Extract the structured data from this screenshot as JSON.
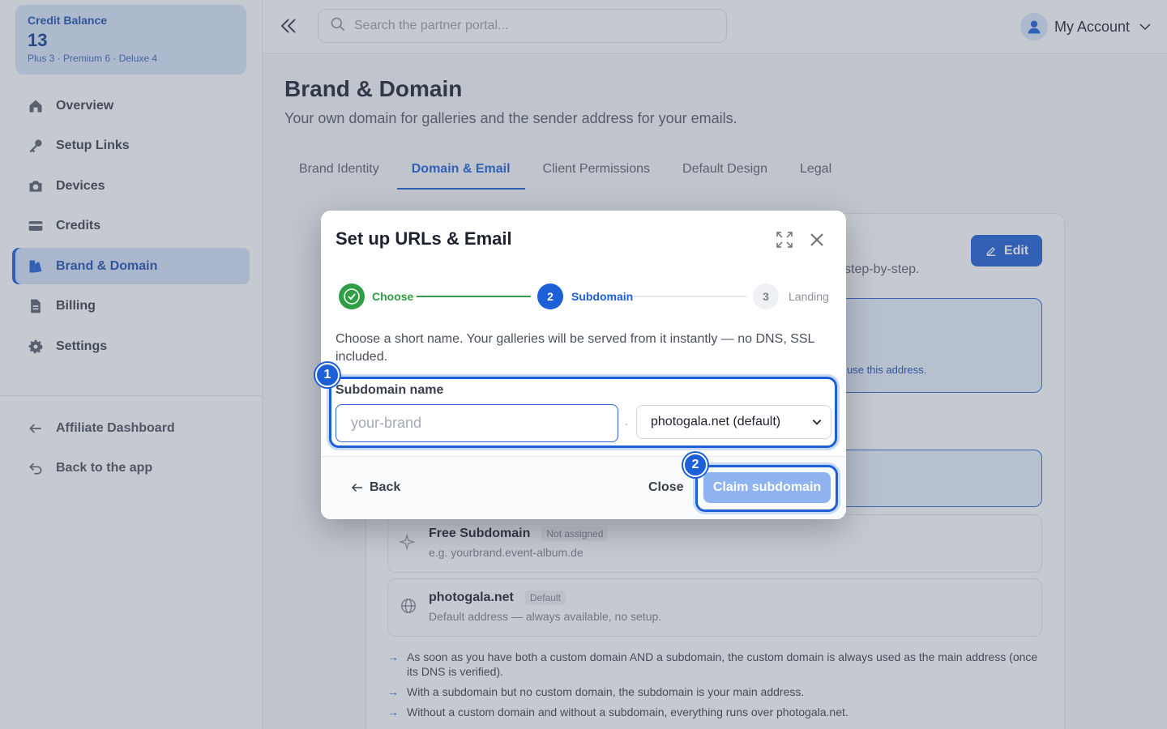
{
  "sidebar": {
    "credit": {
      "label": "Credit Balance",
      "value": "13",
      "detail": "Plus 3 · Premium 6 · Deluxe 4"
    },
    "items": [
      {
        "label": "Overview",
        "icon": "home-icon"
      },
      {
        "label": "Setup Links",
        "icon": "key-icon"
      },
      {
        "label": "Devices",
        "icon": "camera-icon"
      },
      {
        "label": "Credits",
        "icon": "credit-card-icon"
      },
      {
        "label": "Brand & Domain",
        "icon": "brand-icon",
        "active": true
      },
      {
        "label": "Billing",
        "icon": "document-icon"
      },
      {
        "label": "Settings",
        "icon": "gear-icon"
      }
    ],
    "secondary": [
      {
        "label": "Affiliate Dashboard",
        "icon": "arrow-left-icon"
      },
      {
        "label": "Back to the app",
        "icon": "return-icon"
      }
    ]
  },
  "topbar": {
    "search_placeholder": "Search the partner portal...",
    "account_label": "My Account"
  },
  "page": {
    "title": "Brand & Domain",
    "subtitle": "Your own domain for galleries and the sender address for your emails.",
    "tabs": [
      "Brand Identity",
      "Domain & Email",
      "Client Permissions",
      "Default Design",
      "Legal"
    ],
    "active_tab": "Domain & Email",
    "edit_label": "Edit",
    "hint_fragment": "step-by-step.",
    "info_fragment": "use this address.",
    "options": [
      {
        "title": "Free Subdomain",
        "badge": "Not assigned",
        "sub": "e.g. yourbrand.event-album.de"
      },
      {
        "title": "photogala.net",
        "badge": "Default",
        "sub": "Default address — always available, no setup."
      }
    ],
    "bullets": [
      "As soon as you have both a custom domain AND a subdomain, the custom domain is always used as the main address (once its DNS is verified).",
      "With a subdomain but no custom domain, the subdomain is your main address.",
      "Without a custom domain and without a subdomain, everything runs over photogala.net."
    ]
  },
  "modal": {
    "title": "Set up URLs & Email",
    "steps": [
      {
        "num": "",
        "label": "Choose",
        "state": "done"
      },
      {
        "num": "2",
        "label": "Subdomain",
        "state": "active"
      },
      {
        "num": "3",
        "label": "Landing",
        "state": "pending"
      }
    ],
    "description": "Choose a short name. Your galleries will be served from it instantly — no DNS, SSL included.",
    "field_label": "Subdomain name",
    "input_placeholder": "your-brand",
    "input_value": "",
    "separator": ".",
    "domain_select": "photogala.net (default)",
    "back_label": "Back",
    "close_label": "Close",
    "claim_label": "Claim subdomain"
  },
  "markers": [
    "1",
    "2"
  ],
  "colors": {
    "accent": "#1d5fd6",
    "success": "#2f9e44"
  }
}
